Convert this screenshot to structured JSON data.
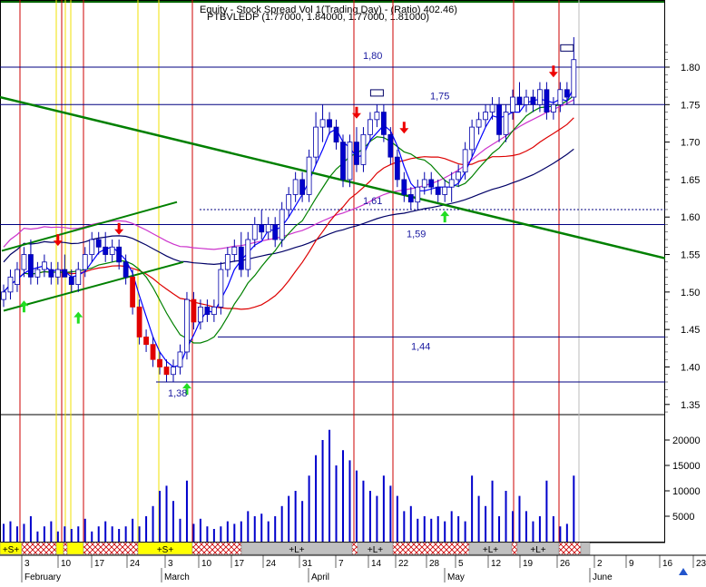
{
  "chart_data": {
    "type": "candlestick",
    "header": {
      "line1": "Equity - Stock Spread Vol 1(Trading Day) - (Ratio) 402.46)",
      "line2": "PTBVLEDP (1.77000, 1.84000, 1.77000, 1.81000)"
    },
    "price_axis": {
      "ticks": [
        "1.80",
        "1.75",
        "1.70",
        "1.65",
        "1.60",
        "1.55",
        "1.50",
        "1.45",
        "1.40",
        "1.35"
      ],
      "tick_values": [
        1.8,
        1.75,
        1.7,
        1.65,
        1.6,
        1.55,
        1.5,
        1.45,
        1.4,
        1.35
      ],
      "range": [
        1.335,
        1.845
      ]
    },
    "volume_axis": {
      "ticks": [
        "20000",
        "15000",
        "10000",
        "5000"
      ],
      "tick_values": [
        20000,
        15000,
        10000,
        5000
      ],
      "range": [
        0,
        25000
      ]
    },
    "x_axis": {
      "day_ticks": [
        "3",
        "10",
        "17",
        "24",
        "3",
        "10",
        "17",
        "24",
        "31",
        "7",
        "14",
        "22",
        "28",
        "5",
        "12",
        "19",
        "26",
        "2",
        "9",
        "16",
        "23"
      ],
      "months": [
        "February",
        "March",
        "April",
        "May",
        "June"
      ]
    },
    "level_labels": [
      "1,80",
      "1,75",
      "1,61",
      "1,59",
      "1,44",
      "1,38"
    ],
    "level_values": [
      1.8,
      1.75,
      1.61,
      1.59,
      1.44,
      1.38
    ],
    "signal_segments": [
      "+S+",
      "+S+",
      "+L+",
      "+L+",
      "+L+",
      "+L+"
    ],
    "candles": [
      {
        "o": 1.49,
        "h": 1.51,
        "l": 1.48,
        "c": 1.5
      },
      {
        "o": 1.5,
        "h": 1.53,
        "l": 1.49,
        "c": 1.52
      },
      {
        "o": 1.51,
        "h": 1.54,
        "l": 1.5,
        "c": 1.53
      },
      {
        "o": 1.53,
        "h": 1.56,
        "l": 1.52,
        "c": 1.55
      },
      {
        "o": 1.55,
        "h": 1.57,
        "l": 1.51,
        "c": 1.52
      },
      {
        "o": 1.52,
        "h": 1.54,
        "l": 1.51,
        "c": 1.53
      },
      {
        "o": 1.53,
        "h": 1.55,
        "l": 1.52,
        "c": 1.54
      },
      {
        "o": 1.53,
        "h": 1.54,
        "l": 1.51,
        "c": 1.52
      },
      {
        "o": 1.52,
        "h": 1.54,
        "l": 1.51,
        "c": 1.53
      },
      {
        "o": 1.53,
        "h": 1.55,
        "l": 1.52,
        "c": 1.52
      },
      {
        "o": 1.52,
        "h": 1.53,
        "l": 1.5,
        "c": 1.51
      },
      {
        "o": 1.51,
        "h": 1.54,
        "l": 1.5,
        "c": 1.53
      },
      {
        "o": 1.53,
        "h": 1.56,
        "l": 1.52,
        "c": 1.55
      },
      {
        "o": 1.55,
        "h": 1.58,
        "l": 1.54,
        "c": 1.57
      },
      {
        "o": 1.57,
        "h": 1.58,
        "l": 1.55,
        "c": 1.56
      },
      {
        "o": 1.56,
        "h": 1.58,
        "l": 1.54,
        "c": 1.55
      },
      {
        "o": 1.55,
        "h": 1.57,
        "l": 1.54,
        "c": 1.56
      },
      {
        "o": 1.56,
        "h": 1.57,
        "l": 1.53,
        "c": 1.54
      },
      {
        "o": 1.54,
        "h": 1.55,
        "l": 1.51,
        "c": 1.52
      },
      {
        "o": 1.52,
        "h": 1.53,
        "l": 1.47,
        "c": 1.48
      },
      {
        "o": 1.48,
        "h": 1.49,
        "l": 1.43,
        "c": 1.44
      },
      {
        "o": 1.44,
        "h": 1.45,
        "l": 1.42,
        "c": 1.43
      },
      {
        "o": 1.43,
        "h": 1.44,
        "l": 1.4,
        "c": 1.41
      },
      {
        "o": 1.41,
        "h": 1.42,
        "l": 1.39,
        "c": 1.4
      },
      {
        "o": 1.4,
        "h": 1.41,
        "l": 1.38,
        "c": 1.39
      },
      {
        "o": 1.39,
        "h": 1.41,
        "l": 1.38,
        "c": 1.4
      },
      {
        "o": 1.4,
        "h": 1.43,
        "l": 1.39,
        "c": 1.42
      },
      {
        "o": 1.42,
        "h": 1.5,
        "l": 1.41,
        "c": 1.49
      },
      {
        "o": 1.49,
        "h": 1.5,
        "l": 1.45,
        "c": 1.46
      },
      {
        "o": 1.46,
        "h": 1.49,
        "l": 1.45,
        "c": 1.48
      },
      {
        "o": 1.48,
        "h": 1.49,
        "l": 1.46,
        "c": 1.47
      },
      {
        "o": 1.47,
        "h": 1.49,
        "l": 1.46,
        "c": 1.48
      },
      {
        "o": 1.48,
        "h": 1.54,
        "l": 1.47,
        "c": 1.53
      },
      {
        "o": 1.53,
        "h": 1.56,
        "l": 1.52,
        "c": 1.55
      },
      {
        "o": 1.55,
        "h": 1.57,
        "l": 1.54,
        "c": 1.56
      },
      {
        "o": 1.56,
        "h": 1.58,
        "l": 1.52,
        "c": 1.53
      },
      {
        "o": 1.53,
        "h": 1.58,
        "l": 1.52,
        "c": 1.57
      },
      {
        "o": 1.57,
        "h": 1.6,
        "l": 1.56,
        "c": 1.59
      },
      {
        "o": 1.59,
        "h": 1.61,
        "l": 1.57,
        "c": 1.58
      },
      {
        "o": 1.58,
        "h": 1.6,
        "l": 1.57,
        "c": 1.59
      },
      {
        "o": 1.59,
        "h": 1.6,
        "l": 1.56,
        "c": 1.57
      },
      {
        "o": 1.57,
        "h": 1.62,
        "l": 1.56,
        "c": 1.61
      },
      {
        "o": 1.61,
        "h": 1.64,
        "l": 1.6,
        "c": 1.63
      },
      {
        "o": 1.63,
        "h": 1.66,
        "l": 1.62,
        "c": 1.65
      },
      {
        "o": 1.65,
        "h": 1.66,
        "l": 1.62,
        "c": 1.63
      },
      {
        "o": 1.63,
        "h": 1.69,
        "l": 1.62,
        "c": 1.68
      },
      {
        "o": 1.68,
        "h": 1.74,
        "l": 1.67,
        "c": 1.72
      },
      {
        "o": 1.72,
        "h": 1.75,
        "l": 1.7,
        "c": 1.73
      },
      {
        "o": 1.73,
        "h": 1.74,
        "l": 1.71,
        "c": 1.72
      },
      {
        "o": 1.72,
        "h": 1.73,
        "l": 1.69,
        "c": 1.7
      },
      {
        "o": 1.7,
        "h": 1.71,
        "l": 1.64,
        "c": 1.65
      },
      {
        "o": 1.65,
        "h": 1.71,
        "l": 1.64,
        "c": 1.7
      },
      {
        "o": 1.7,
        "h": 1.72,
        "l": 1.66,
        "c": 1.67
      },
      {
        "o": 1.67,
        "h": 1.72,
        "l": 1.66,
        "c": 1.71
      },
      {
        "o": 1.71,
        "h": 1.74,
        "l": 1.7,
        "c": 1.73
      },
      {
        "o": 1.73,
        "h": 1.75,
        "l": 1.72,
        "c": 1.74
      },
      {
        "o": 1.74,
        "h": 1.75,
        "l": 1.7,
        "c": 1.71
      },
      {
        "o": 1.71,
        "h": 1.72,
        "l": 1.67,
        "c": 1.68
      },
      {
        "o": 1.68,
        "h": 1.69,
        "l": 1.64,
        "c": 1.65
      },
      {
        "o": 1.65,
        "h": 1.66,
        "l": 1.62,
        "c": 1.63
      },
      {
        "o": 1.63,
        "h": 1.64,
        "l": 1.61,
        "c": 1.62
      },
      {
        "o": 1.62,
        "h": 1.65,
        "l": 1.61,
        "c": 1.64
      },
      {
        "o": 1.64,
        "h": 1.66,
        "l": 1.63,
        "c": 1.65
      },
      {
        "o": 1.65,
        "h": 1.66,
        "l": 1.63,
        "c": 1.64
      },
      {
        "o": 1.64,
        "h": 1.65,
        "l": 1.62,
        "c": 1.63
      },
      {
        "o": 1.63,
        "h": 1.65,
        "l": 1.62,
        "c": 1.64
      },
      {
        "o": 1.64,
        "h": 1.66,
        "l": 1.62,
        "c": 1.65
      },
      {
        "o": 1.65,
        "h": 1.67,
        "l": 1.64,
        "c": 1.66
      },
      {
        "o": 1.66,
        "h": 1.7,
        "l": 1.65,
        "c": 1.69
      },
      {
        "o": 1.69,
        "h": 1.73,
        "l": 1.68,
        "c": 1.72
      },
      {
        "o": 1.72,
        "h": 1.74,
        "l": 1.71,
        "c": 1.73
      },
      {
        "o": 1.73,
        "h": 1.75,
        "l": 1.72,
        "c": 1.74
      },
      {
        "o": 1.74,
        "h": 1.76,
        "l": 1.73,
        "c": 1.75
      },
      {
        "o": 1.75,
        "h": 1.76,
        "l": 1.7,
        "c": 1.71
      },
      {
        "o": 1.71,
        "h": 1.75,
        "l": 1.7,
        "c": 1.74
      },
      {
        "o": 1.74,
        "h": 1.77,
        "l": 1.73,
        "c": 1.76
      },
      {
        "o": 1.76,
        "h": 1.78,
        "l": 1.74,
        "c": 1.75
      },
      {
        "o": 1.75,
        "h": 1.77,
        "l": 1.74,
        "c": 1.76
      },
      {
        "o": 1.76,
        "h": 1.77,
        "l": 1.74,
        "c": 1.75
      },
      {
        "o": 1.75,
        "h": 1.78,
        "l": 1.74,
        "c": 1.77
      },
      {
        "o": 1.77,
        "h": 1.78,
        "l": 1.73,
        "c": 1.74
      },
      {
        "o": 1.74,
        "h": 1.76,
        "l": 1.73,
        "c": 1.75
      },
      {
        "o": 1.75,
        "h": 1.78,
        "l": 1.74,
        "c": 1.77
      },
      {
        "o": 1.77,
        "h": 1.78,
        "l": 1.75,
        "c": 1.76
      },
      {
        "o": 1.76,
        "h": 1.84,
        "l": 1.75,
        "c": 1.81
      }
    ],
    "volumes": [
      3500,
      4000,
      3000,
      3500,
      5000,
      2000,
      3000,
      4000,
      2000,
      3000,
      2500,
      3000,
      4500,
      2000,
      3000,
      4000,
      3000,
      2500,
      3000,
      4500,
      3000,
      5000,
      7000,
      10000,
      11000,
      8000,
      4500,
      12000,
      3500,
      4500,
      3000,
      2500,
      3000,
      4000,
      3500,
      4000,
      6000,
      5000,
      5500,
      4000,
      5000,
      7000,
      9000,
      10000,
      8000,
      13000,
      17000,
      20000,
      22000,
      15000,
      18000,
      16000,
      14000,
      12000,
      10000,
      9000,
      13000,
      11000,
      9000,
      6000,
      7000,
      4500,
      5000,
      4500,
      5000,
      4000,
      6000,
      5000,
      4000,
      13000,
      9000,
      7000,
      12000,
      5000,
      10000,
      6000,
      9000,
      6000,
      4000,
      5000,
      12000,
      5000,
      3000,
      3500,
      13000
    ],
    "indicator_colors": {
      "up_candle": "#ffffff",
      "down_candle": "#0000cc",
      "candle_outline": "#0000aa",
      "ma_short": "#0000ff",
      "ma_mid": "#008000",
      "ma_long": "#dd0000",
      "ma_magenta": "#cc33cc",
      "ma_navy": "#000066",
      "trendline": "#008000",
      "level_line": "#000080",
      "vertical_line": "#cc0000",
      "yellow_line": "#f0e000",
      "volume_bar": "#0000cc",
      "signal_short": "#ffff00",
      "signal_long": "#c0c0c0",
      "signal_hatch": "#cc0000"
    }
  }
}
